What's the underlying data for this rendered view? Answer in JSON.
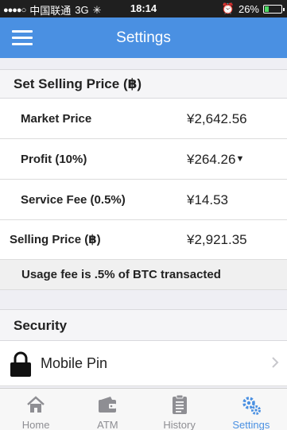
{
  "status_bar": {
    "carrier": "中国联通",
    "network": "3G",
    "time": "18:14",
    "battery": "26%",
    "battery_level": 0.26
  },
  "nav": {
    "title": "Settings",
    "menu_icon": "hamburger-icon"
  },
  "selling_section": {
    "title": "Set Selling Price (฿)",
    "market_price_label": "Market Price",
    "market_price_value": "¥2,642.56",
    "profit_label": "Profit  (10%)",
    "profit_value": "¥264.26",
    "service_fee_label": "Service Fee  (0.5%)",
    "service_fee_value": "¥14.53",
    "selling_price_label": "Selling Price (฿)",
    "selling_price_value": "¥2,921.35",
    "notice": "Usage fee is .5% of BTC transacted"
  },
  "security_section": {
    "title": "Security",
    "mobile_pin_label": "Mobile Pin"
  },
  "tab_bar": {
    "tabs": [
      {
        "label": "Home",
        "icon": "home-icon"
      },
      {
        "label": "ATM",
        "icon": "wallet-icon"
      },
      {
        "label": "History",
        "icon": "clipboard-icon"
      },
      {
        "label": "Settings",
        "icon": "gear-icon"
      }
    ],
    "active": "Settings"
  },
  "colors": {
    "accent": "#4a90e2",
    "status_bar": "#1f1f1f",
    "battery": "#4cd964"
  }
}
